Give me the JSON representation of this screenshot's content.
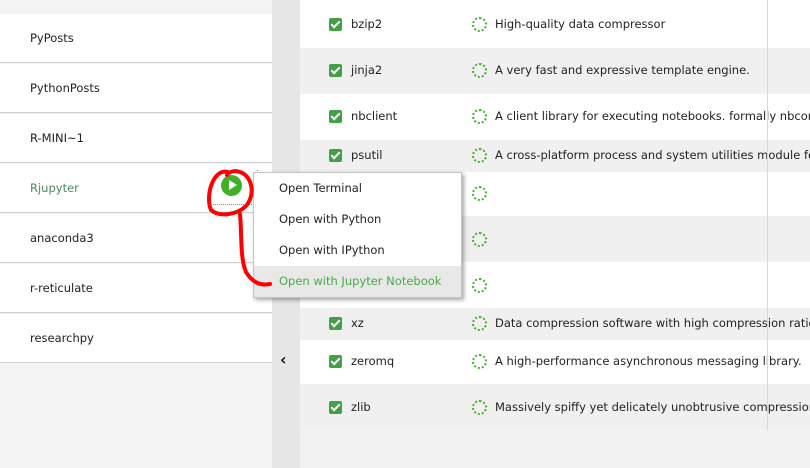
{
  "environments": [
    {
      "label": "PyPosts"
    },
    {
      "label": "PythonPosts"
    },
    {
      "label": "R-MINI~1"
    },
    {
      "label": "Rjupyter",
      "selected": true
    },
    {
      "label": "anaconda3"
    },
    {
      "label": "r-reticulate"
    },
    {
      "label": "researchpy"
    }
  ],
  "context_menu": {
    "items": [
      {
        "label": "Open Terminal"
      },
      {
        "label": "Open with Python"
      },
      {
        "label": "Open with IPython"
      },
      {
        "label": "Open with Jupyter Notebook",
        "highlighted": true
      }
    ]
  },
  "packages": [
    {
      "name": "bzip2",
      "description": "High-quality data compressor"
    },
    {
      "name": "jinja2",
      "description": "A very fast and expressive template engine."
    },
    {
      "name": "nbclient",
      "description": "A client library for executing notebooks. formally nbconvert"
    },
    {
      "name": "psutil",
      "description": "A cross-platform process and system utilities module for pyt"
    },
    {
      "name": "",
      "description": ""
    },
    {
      "name": "",
      "description": ""
    },
    {
      "name": "",
      "description": ""
    },
    {
      "name": "xz",
      "description": "Data compression software with high compression ratio"
    },
    {
      "name": "zeromq",
      "description": "A high-performance asynchronous messaging library."
    },
    {
      "name": "zlib",
      "description": "Massively spiffy yet delicately unobtrusive compression libra"
    }
  ],
  "icons": {
    "collapse": "chevron-left-icon",
    "play": "play-icon",
    "status": "status-circle-icon",
    "checked": "checkbox-checked-icon"
  },
  "colors": {
    "accent_green": "#43b02a",
    "checkbox_green": "#43a047",
    "annotation_red": "#ff0000",
    "selected_text": "#4a8a5e"
  }
}
